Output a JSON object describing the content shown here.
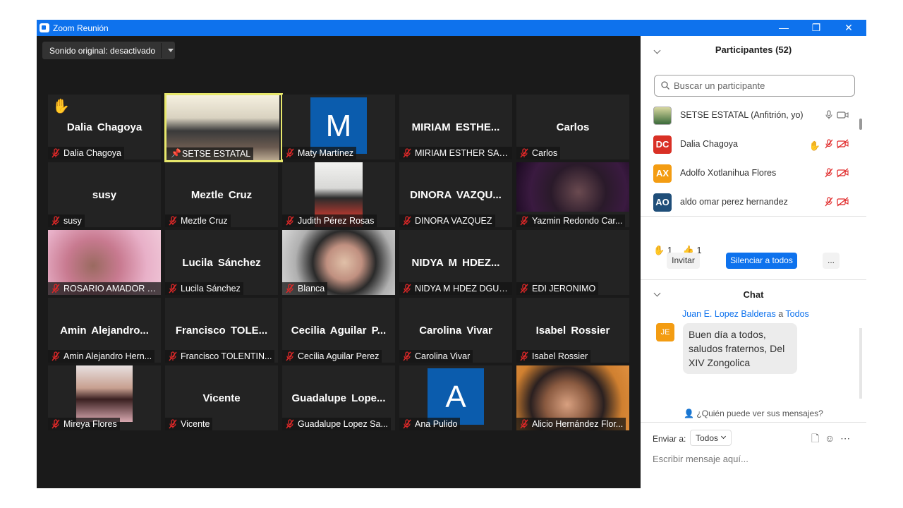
{
  "window": {
    "title": "Zoom Reunión",
    "min": "—",
    "max": "❐",
    "close": "✕"
  },
  "audio": {
    "label": "Sonido original: desactivado"
  },
  "tiles": [
    {
      "big": "Dalia Chagoya",
      "name": "Dalia Chagoya",
      "hand": "✋"
    },
    {
      "big": "",
      "name": "SETSE ESTATAL"
    },
    {
      "big": "",
      "name": "Maty Martínez",
      "avatar": "M"
    },
    {
      "big": "MIRIAM ESTHE...",
      "name": "MIRIAM ESTHER SAN..."
    },
    {
      "big": "Carlos",
      "name": "Carlos"
    },
    {
      "big": "susy",
      "name": "susy"
    },
    {
      "big": "Meztle Cruz",
      "name": "Meztle Cruz"
    },
    {
      "big": "",
      "name": "Judith Pérez Rosas"
    },
    {
      "big": "DINORA VAZQU...",
      "name": "DINORA VAZQUEZ"
    },
    {
      "big": "",
      "name": "Yazmin Redondo Car..."
    },
    {
      "big": "",
      "name": "ROSARIO AMADOR T..."
    },
    {
      "big": "Lucila Sánchez",
      "name": "Lucila Sánchez"
    },
    {
      "big": "",
      "name": "Blanca"
    },
    {
      "big": "NIDYA M HDEZ...",
      "name": "NIDYA M HDEZ DGUEZ"
    },
    {
      "big": "",
      "name": "EDI JERONIMO"
    },
    {
      "big": "Amin Alejandro...",
      "name": "Amin Alejandro Hern..."
    },
    {
      "big": "Francisco TOLE...",
      "name": "Francisco TOLENTIN..."
    },
    {
      "big": "Cecilia Aguilar P...",
      "name": "Cecilia Aguilar Perez"
    },
    {
      "big": "Carolina Vivar",
      "name": "Carolina Vivar"
    },
    {
      "big": "Isabel Rossier",
      "name": "Isabel Rossier"
    },
    {
      "big": "",
      "name": "Mireya Flores"
    },
    {
      "big": "Vicente",
      "name": "Vicente"
    },
    {
      "big": "Guadalupe Lope...",
      "name": "Guadalupe Lopez Sa..."
    },
    {
      "big": "",
      "name": "Ana Pulido",
      "avatar": "A"
    },
    {
      "big": "",
      "name": "Alicio Hernández Flor..."
    }
  ],
  "participants": {
    "header": "Participantes (52)",
    "search_placeholder": "Buscar un participante",
    "list": [
      {
        "initials": "",
        "name": "SETSE ESTATAL (Anfitrión, yo)"
      },
      {
        "initials": "DC",
        "name": "Dalia Chagoya",
        "color": "#d93025"
      },
      {
        "initials": "AX",
        "name": "Adolfo Xotlanihua Flores",
        "color": "#f39c12"
      },
      {
        "initials": "AO",
        "name": "aldo omar perez hernandez",
        "color": "#1f4e79"
      }
    ],
    "reactions": {
      "hand": "✋",
      "hand_count": "1",
      "thumb": "👍",
      "thumb_count": "1"
    },
    "invite": "Invitar",
    "mute_all": "Silenciar a todos",
    "more": "..."
  },
  "chat": {
    "header": "Chat",
    "sender": "Juan E. Lopez Balderas",
    "to_word": "a",
    "recipient": "Todos",
    "avatar": "JE",
    "message": "Buen día a todos, saludos fraternos, Del XIV Zongolica",
    "who_can_see": "¿Quién puede ver sus mensajes?",
    "send_to_label": "Enviar a:",
    "send_to_value": "Todos",
    "input_placeholder": "Escribir mensaje aquí..."
  },
  "colors": {
    "accent": "#0e72ed",
    "muted_red": "#e02828",
    "avatar_blue": "#0b5cad",
    "active_border": "#e8e86c"
  }
}
